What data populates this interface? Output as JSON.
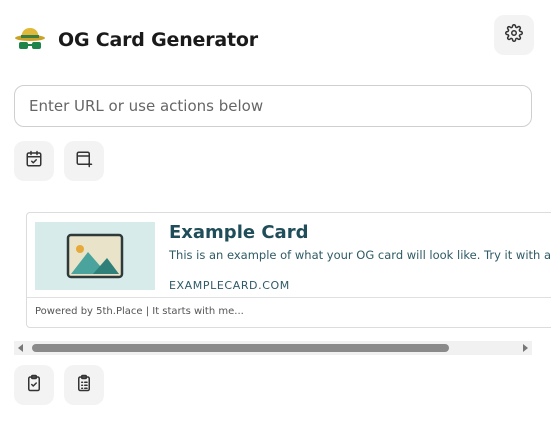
{
  "app": {
    "title": "OG Card Generator",
    "logo_icon": "detective-hat-glasses-icon",
    "settings_icon": "gear-icon"
  },
  "url_input": {
    "placeholder": "Enter URL or use actions below",
    "value": ""
  },
  "actions_top": [
    {
      "icon": "calendar-check-icon"
    },
    {
      "icon": "browser-window-add-icon"
    }
  ],
  "card": {
    "title": "Example Card",
    "description": "This is an example of what your OG card will look like. Try it with a",
    "url": "EXAMPLECARD.COM",
    "footer": "Powered by 5th.Place | It starts with me...",
    "image_icon": "image-placeholder-icon"
  },
  "scrollbar": {
    "position_fraction": 0.0,
    "visible_fraction": 0.82
  },
  "actions_bottom": [
    {
      "icon": "clipboard-check-icon"
    },
    {
      "icon": "clipboard-list-icon"
    }
  ],
  "colors": {
    "card_title": "#1f4e5a",
    "card_text": "#2f5a66",
    "button_bg": "#f3f3f3",
    "image_bg": "#d4e8e8"
  }
}
